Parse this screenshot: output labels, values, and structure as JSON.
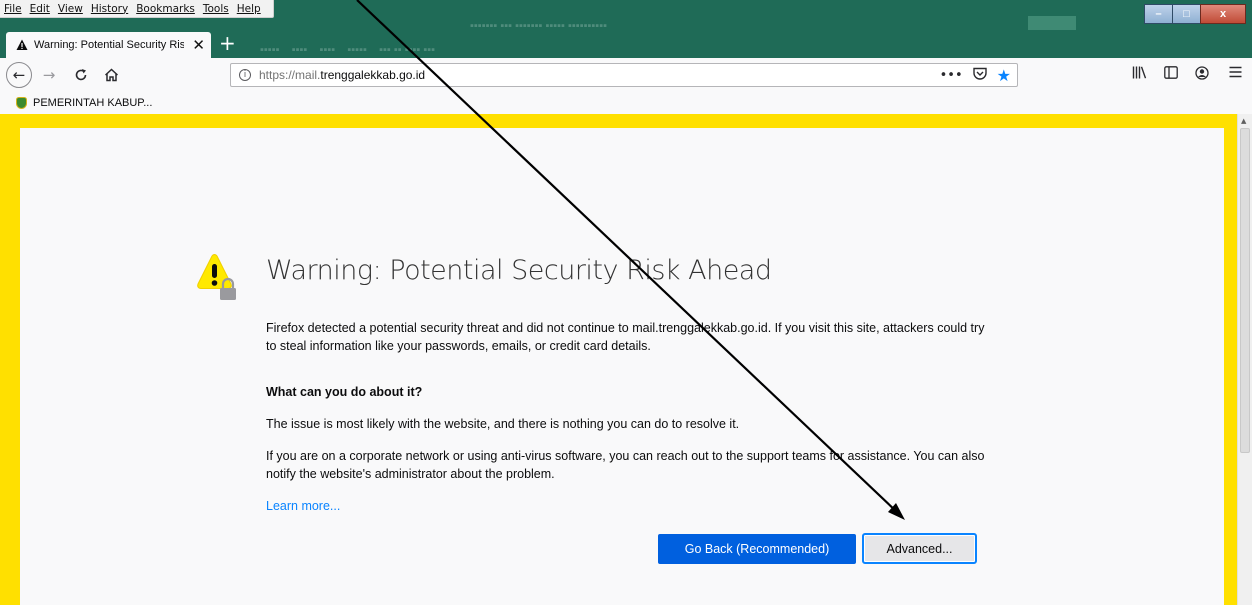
{
  "menubar": {
    "items": [
      "File",
      "Edit",
      "View",
      "History",
      "Bookmarks",
      "Tools",
      "Help"
    ]
  },
  "window_controls": {
    "minimize": "–",
    "maximize": "□",
    "close": "x"
  },
  "tab": {
    "title": "Warning: Potential Security Risk Ahead",
    "close": "✕"
  },
  "new_tab": "+",
  "navbar": {
    "url_prefix": "https://mail.",
    "url_domain": "trenggalekkab.go.id",
    "page_actions": "•••"
  },
  "bookmarks": {
    "items": [
      {
        "label": "PEMERINTAH KABUP..."
      }
    ]
  },
  "error_page": {
    "title": "Warning: Potential Security Risk Ahead",
    "intro": "Firefox detected a potential security threat and did not continue to mail.trenggalekkab.go.id. If you visit this site, attackers could try to steal information like your passwords, emails, or credit card details.",
    "what_heading": "What can you do about it?",
    "para1": "The issue is most likely with the website, and there is nothing you can do to resolve it.",
    "para2": "If you are on a corporate network or using anti-virus software, you can reach out to the support teams for assistance. You can also notify the website's administrator about the problem.",
    "learn_more": "Learn more...",
    "go_back_button": "Go Back (Recommended)",
    "advanced_button": "Advanced..."
  },
  "colors": {
    "frame_border": "#ffe000",
    "primary_button": "#0060df",
    "link": "#0a84ff",
    "titlebar": "#1f6b57"
  },
  "icons": [
    "warning-triangle-icon",
    "back-arrow-icon",
    "forward-arrow-icon",
    "reload-icon",
    "home-icon",
    "info-icon",
    "pocket-icon",
    "bookmark-star-icon",
    "library-icon",
    "sidebar-icon",
    "account-icon",
    "hamburger-menu-icon",
    "warning-lock-icon"
  ]
}
